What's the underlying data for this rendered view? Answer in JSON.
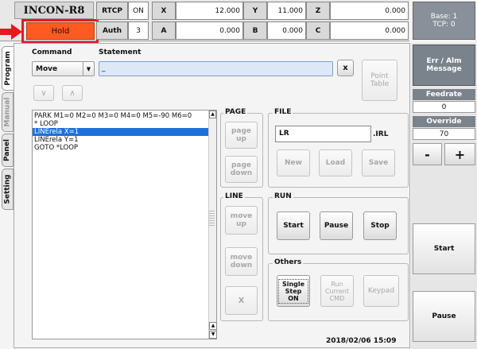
{
  "header": {
    "title": "INCON-R8",
    "hold_label": "Hold",
    "row1": {
      "rtcp_label": "RTCP",
      "rtcp_value": "ON",
      "x_label": "X",
      "x_value": "12.000",
      "y_label": "Y",
      "y_value": "11.000",
      "z_label": "Z",
      "z_value": "0.000"
    },
    "row2": {
      "auth_label": "Auth",
      "auth_value": "3",
      "a_label": "A",
      "a_value": "0.000",
      "b_label": "B",
      "b_value": "0.000",
      "c_label": "C",
      "c_value": "0.000"
    },
    "base_label": "Base: 1",
    "tcp_label": "TCP: 0"
  },
  "tabs": [
    {
      "label": "Program"
    },
    {
      "label": "Manual"
    },
    {
      "label": "Panel"
    },
    {
      "label": "Setting"
    }
  ],
  "editor": {
    "command_label": "Command",
    "statement_label": "Statement",
    "command_value": "Move",
    "statement_value": "_",
    "clear_label": "x",
    "point_table_label": "Point\nTable",
    "down_arrow": "∨",
    "up_arrow": "∧"
  },
  "program_lines": [
    "PARK M1=0 M2=0 M3=0 M4=0 M5=-90 M6=0",
    "* LOOP",
    "LINErela X=1",
    "LINErela Y=1",
    "GOTO *LOOP"
  ],
  "page_group": {
    "label": "PAGE",
    "up": "page\nup",
    "down": "page\ndown"
  },
  "file_group": {
    "label": "FILE",
    "filename": "LR",
    "ext": ".IRL",
    "new": "New",
    "load": "Load",
    "save": "Save"
  },
  "line_group": {
    "label": "LINE",
    "up": "move\nup",
    "down": "move\ndown",
    "delete": "X"
  },
  "run_group": {
    "label": "RUN",
    "start": "Start",
    "pause": "Pause",
    "stop": "Stop"
  },
  "others_group": {
    "label": "Others",
    "single_step": "Single\nStep\nON",
    "run_current": "Run\nCurrent\nCMD",
    "keypad": "Keypad"
  },
  "timestamp": "2018/02/06 15:09",
  "right_panel": {
    "err_label": "Err / Alm\nMessage",
    "feedrate_label": "Feedrate",
    "feedrate_value": "0",
    "override_label": "Override",
    "override_value": "70",
    "minus": "-",
    "plus": "+",
    "start": "Start",
    "pause": "Pause"
  },
  "colors": {
    "hold_bg": "#ff5a1f",
    "highlight": "#e8181e",
    "selection": "#1e6fd9",
    "panel_header": "#7a828c"
  }
}
